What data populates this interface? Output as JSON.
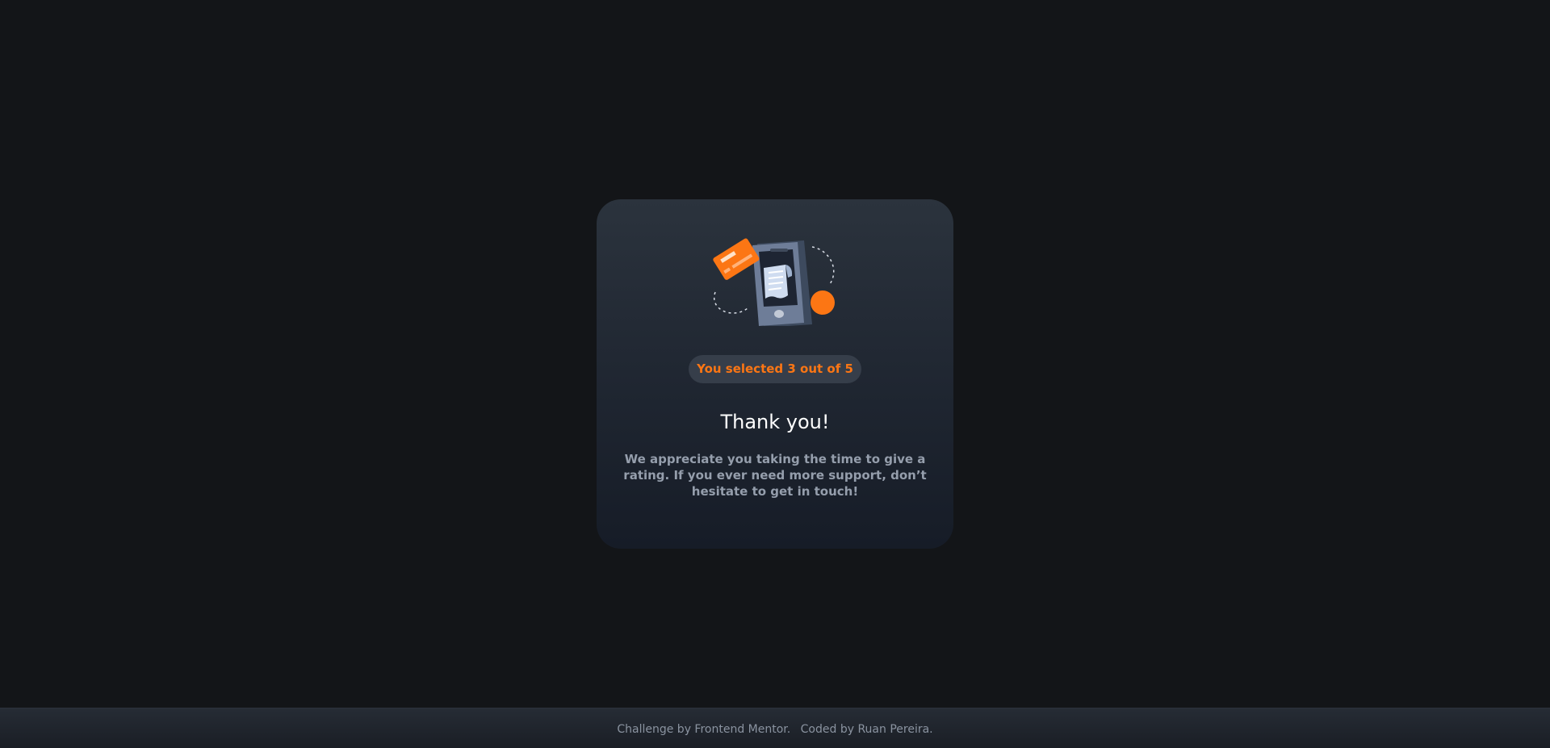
{
  "card": {
    "illustration_icon": "payment-phone-illustration-icon",
    "badge_text": "You selected 3 out of 5",
    "title": "Thank you!",
    "message": "We appreciate you taking the time to give a rating. If you ever need more support, don’t hesitate to get in touch!"
  },
  "footer": {
    "challenge_text": "Challenge by Frontend Mentor.",
    "coded_text": "Coded by Ruan Pereira."
  },
  "colors": {
    "accent": "#fc7614",
    "background": "#131518",
    "card_top": "#2b333d",
    "card_bottom": "#161c27",
    "muted_text": "#959eac",
    "white": "#ffffff"
  }
}
